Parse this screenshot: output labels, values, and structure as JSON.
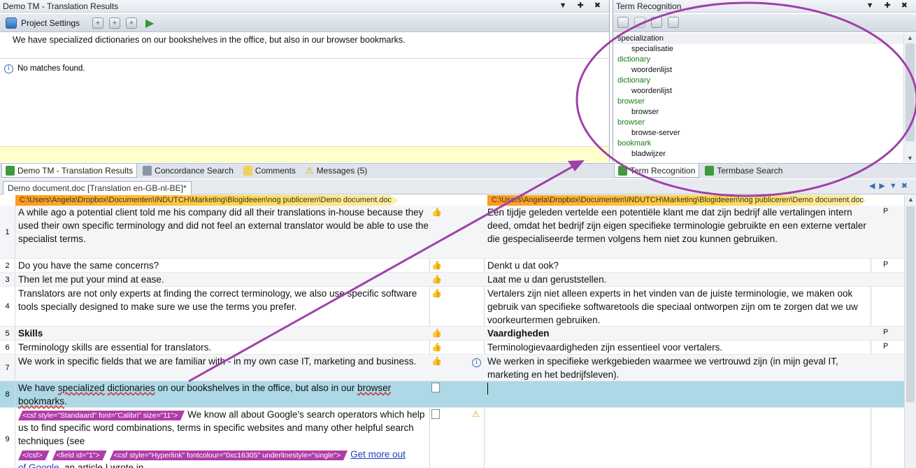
{
  "tm_pane": {
    "title": "Demo TM - Translation Results",
    "controls": "▼ ✚ ✖",
    "project_settings": "Project Settings",
    "source_sentence": "We have specialized dictionaries on our bookshelves in the office, but also in our browser bookmarks.",
    "info_text": "No matches found."
  },
  "term_pane": {
    "title": "Term Recognition",
    "controls": "▼ ✚ ✖",
    "terms": [
      {
        "source": "specialization",
        "target": "specialisatie"
      },
      {
        "source": "dictionary",
        "target": "woordenlijst"
      },
      {
        "source": "dictionary",
        "target": "woordenlijst"
      },
      {
        "source": "browser",
        "target": "browser"
      },
      {
        "source": "browser",
        "target": "browse-server"
      },
      {
        "source": "bookmark",
        "target": "bladwijzer"
      }
    ]
  },
  "bottom_tabs_left": [
    "Demo TM - Translation Results",
    "Concordance Search",
    "Comments",
    "Messages (5)"
  ],
  "bottom_tabs_right": [
    "Term Recognition",
    "Termbase Search"
  ],
  "document_tab": "Demo document.doc [Translation en-GB-nl-BE]*",
  "file_path": "C:\\Users\\Angela\\Dropbox\\Documenten\\INDUTCH\\Marketing\\Blogideeen\\nog publiceren\\Demo document.doc",
  "segments": [
    {
      "num": "1",
      "source": "A while ago a potential client told me his company did all their translations in-house because they used their own specific terminology and did not feel an external translator would be able to use the specialist terms.",
      "target": "Een tijdje geleden vertelde een potentiële klant me dat zijn bedrijf alle vertalingen intern deed, omdat het bedrijf zijn eigen specifieke terminologie gebruikte en een externe vertaler die gespecialiseerde termen volgens hem niet zou kunnen gebruiken.",
      "p": "P"
    },
    {
      "num": "2",
      "source": "Do you have the same concerns?",
      "target": "Denkt u dat ook?",
      "p": "P"
    },
    {
      "num": "3",
      "source": "Then let me put your mind at ease.",
      "target": "Laat me u dan geruststellen.",
      "p": ""
    },
    {
      "num": "4",
      "source": "Translators are not only experts at finding the correct terminology, we also use specific software tools specially designed to make sure we use the terms you prefer.",
      "target": "Vertalers zijn niet alleen experts in het vinden van de juiste terminologie, we maken ook gebruik van specifieke softwaretools die speciaal ontworpen zijn om te zorgen dat we uw voorkeurtermen gebruiken.",
      "p": ""
    },
    {
      "num": "5",
      "source": "Skills",
      "target": "Vaardigheden",
      "p": "P"
    },
    {
      "num": "6",
      "source": "Terminology skills are essential for translators.",
      "target": "Terminologievaardigheden zijn essentieel voor vertalers.",
      "p": "P"
    },
    {
      "num": "7",
      "source": "We work in specific fields that we are familiar with - in my own case IT, marketing and business.",
      "target": "We werken in specifieke werkgebieden waarmee we vertrouwd zijn (in mijn geval IT, marketing en het bedrijfsleven).",
      "p": ""
    },
    {
      "num": "8",
      "source_a": "We have ",
      "source_b": "specialized",
      "source_c": " ",
      "source_d": "dictionaries",
      "source_e": " on our bookshelves in the office, but also in our ",
      "source_f": "browser",
      "source_g": " ",
      "source_h": "bookmarks",
      "source_i": ".",
      "target": "",
      "p": ""
    },
    {
      "num": "9",
      "tag1": "<csf style=\"Standaard\" font=\"Calibri\" size=\"11\">",
      "source": "We know all about Google's search operators which help us to find specific word combinations, terms in specific websites and many other helpful search techniques (see",
      "tag2": "</csf>",
      "tag3": "<field id=\"1\">",
      "tag4": "<csf style=\"Hyperlink\" fontcolour=\"0xc16305\" underlinestyle=\"single\">",
      "link": "Get more out",
      "link2": "of Google",
      "tail": ", an article I wrote in",
      "target": "",
      "p": ""
    }
  ],
  "colors": {
    "accent_row": "#add8e6",
    "annotation": "#a040a8",
    "tag": "#b03ca8"
  }
}
